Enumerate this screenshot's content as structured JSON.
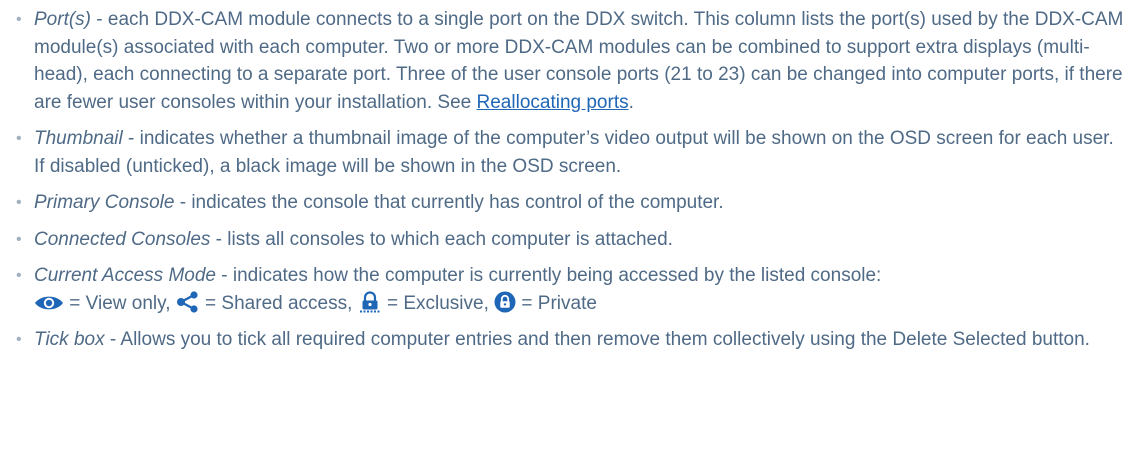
{
  "items": [
    {
      "term": "Port(s)",
      "text": " - each DDX-CAM module connects to a single port on the DDX switch. This column lists the port(s) used by the DDX-CAM module(s) associated with each computer. Two or more DDX-CAM modules can be combined to support extra displays (multi-head), each connecting to a separate port. Three of the user console ports (21 to 23) can be changed into computer ports, if there are fewer user consoles within your installation. See ",
      "link": "Reallocating ports",
      "after_link": "."
    },
    {
      "term": "Thumbnail",
      "text": " - indicates whether a thumbnail image of the computer’s video output will be shown on the OSD screen for each user. If disabled (unticked), a black image will be shown in the OSD screen."
    },
    {
      "term": "Primary Console",
      "text": " - indicates the console that currently has control of the computer."
    },
    {
      "term": "Connected Consoles",
      "text": " - lists all consoles to which each computer is attached."
    },
    {
      "term": "Current Access Mode",
      "text": " - indicates how the computer is currently being accessed by the listed console:",
      "modes": [
        {
          "icon": "eye-icon",
          "label": " = View only, "
        },
        {
          "icon": "share-icon",
          "label": " = Shared access, "
        },
        {
          "icon": "exclusive-lock-icon",
          "label": " = Exclusive, "
        },
        {
          "icon": "private-lock-icon",
          "label": " = Private"
        }
      ]
    },
    {
      "term": "Tick box",
      "text": " - Allows you to tick all required computer entries and then remove them collectively using the Delete Selected button."
    }
  ],
  "colors": {
    "text": "#4f6a86",
    "link": "#1f67b6",
    "icon": "#1f67b6"
  }
}
